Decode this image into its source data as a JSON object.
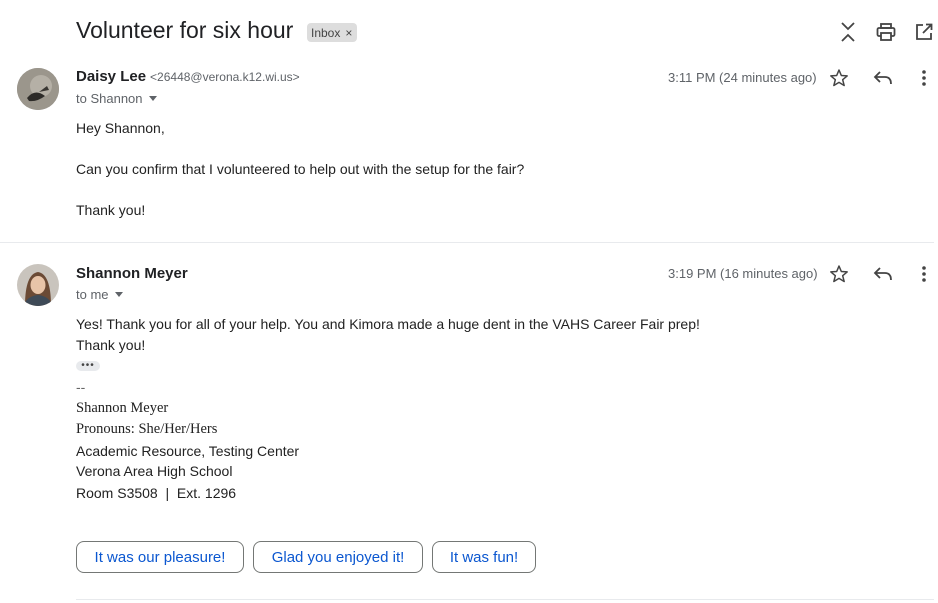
{
  "thread": {
    "subject": "Volunteer for six hour",
    "label_chip": "Inbox",
    "label_remove": "×"
  },
  "toolbar": {
    "collapse_icon": "collapse-all-icon",
    "print_icon": "print-icon",
    "popout_icon": "open-in-new-window-icon"
  },
  "messages": [
    {
      "sender_name": "Daisy Lee",
      "sender_email": "<26448@verona.k12.wi.us>",
      "recipient": "to Shannon",
      "timestamp": "3:11 PM (24 minutes ago)",
      "body": [
        "Hey Shannon,",
        "Can you confirm that I volunteered to help out with the setup for the fair?",
        "Thank you!"
      ]
    },
    {
      "sender_name": "Shannon Meyer",
      "recipient": "to me",
      "timestamp": "3:19 PM (16 minutes ago)",
      "body": [
        "Yes! Thank you for all of your help. You and Kimora made a huge dent in the VAHS Career Fair prep!",
        "Thank you!"
      ],
      "trimmed_content": "•••",
      "signature": {
        "separator": "--",
        "name": "Shannon Meyer",
        "pronouns": "Pronouns: She/Her/Hers",
        "department": "Academic Resource, Testing Center",
        "school": "Verona Area High School",
        "room": "Room S3508  |  Ext. 1296"
      }
    }
  ],
  "smart_replies": [
    "It was our pleasure!",
    "Glad you enjoyed it!",
    "It was fun!"
  ],
  "colors": {
    "link_blue": "#0b57d0",
    "text_primary": "#202124",
    "text_secondary": "#5f6368",
    "chip_bg": "#dddddd",
    "divider": "#e8eaed"
  }
}
